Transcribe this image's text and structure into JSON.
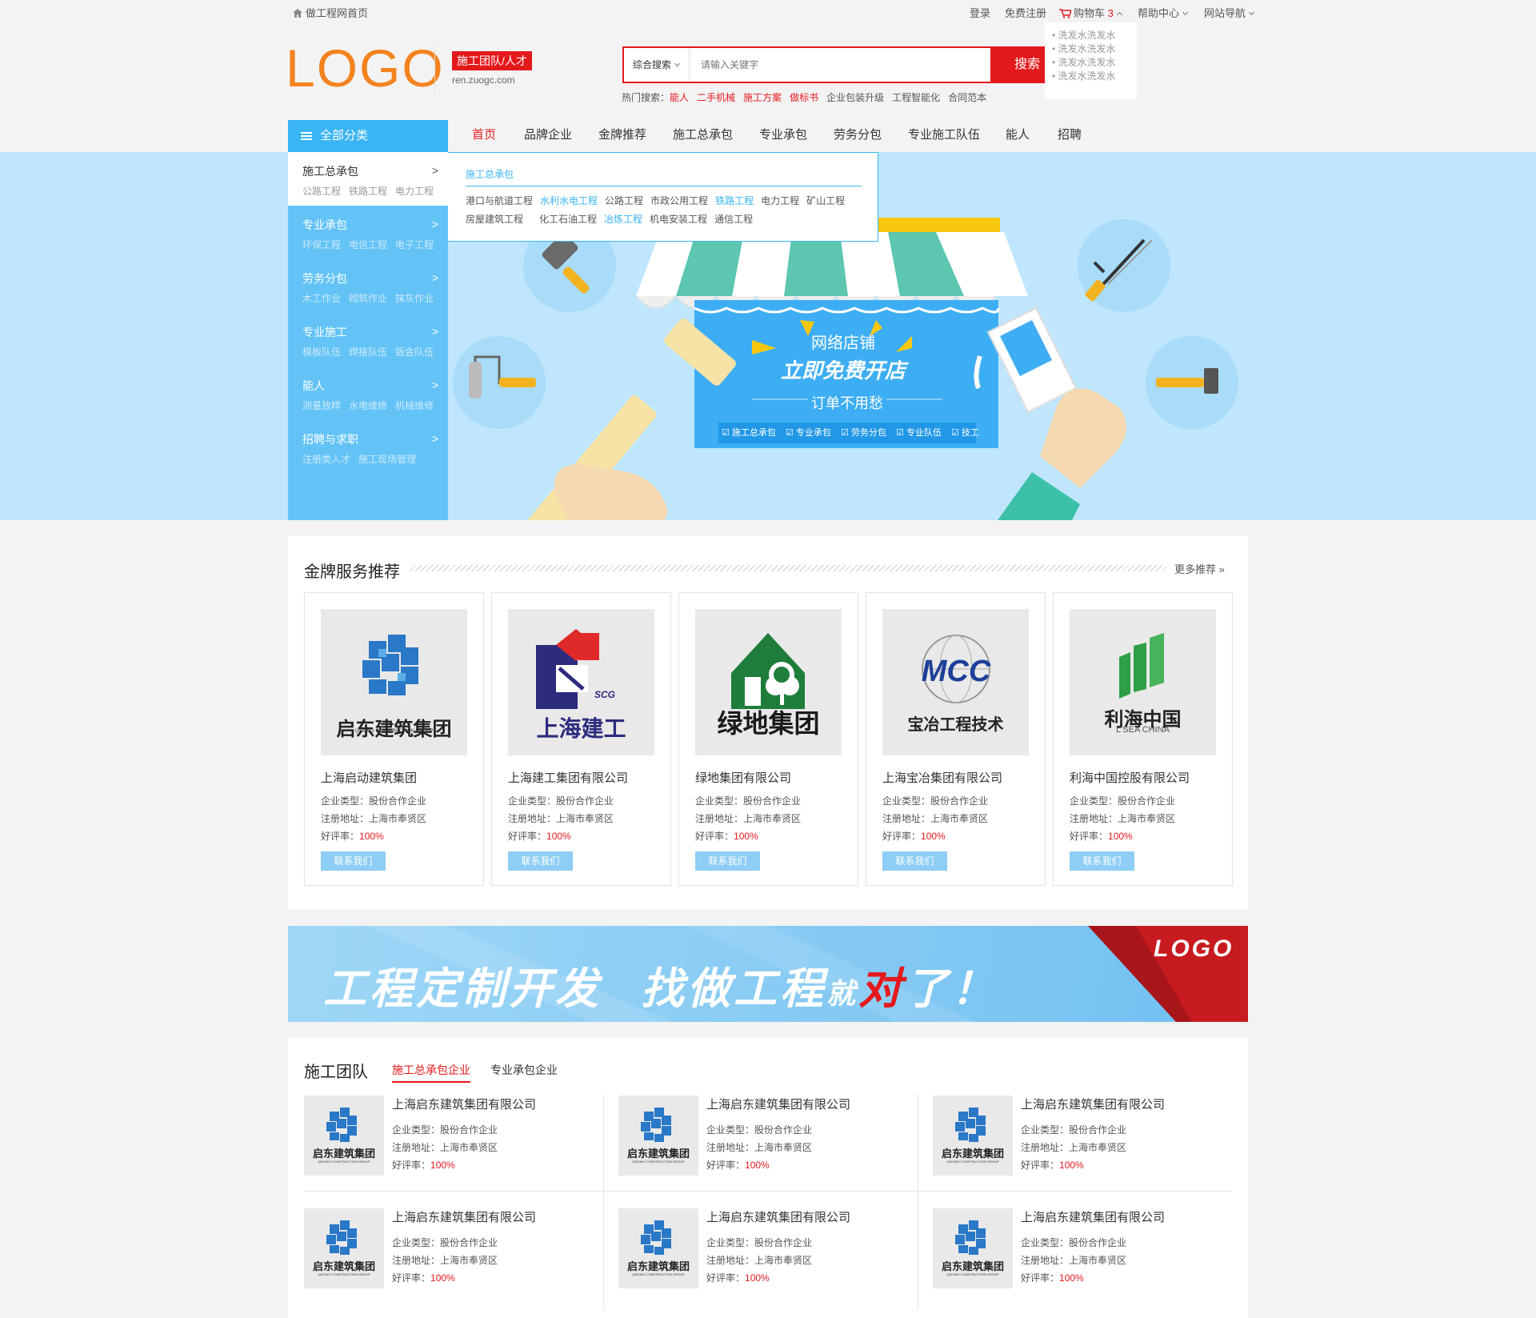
{
  "topbar": {
    "home_link": "做工程网首页",
    "login": "登录",
    "register": "免费注册",
    "cart_label": "购物车",
    "cart_count": "3",
    "help": "帮助中心",
    "sitenav": "网站导航",
    "cart_items": [
      "• 洗发水洗发水",
      "• 洗发水洗发水",
      "• 洗发水洗发水",
      "• 洗发水洗发水"
    ]
  },
  "header": {
    "logo": "LOGO",
    "tag": "施工团队/人才",
    "subsite": "ren.zuogc.com",
    "search_type": "综合搜索",
    "search_placeholder": "请输入关键字",
    "search_button": "搜索",
    "hot_label": "热门搜索：",
    "hot": [
      {
        "t": "能人",
        "red": true
      },
      {
        "t": "二手机械",
        "red": true
      },
      {
        "t": "施工方案",
        "red": true
      },
      {
        "t": "做标书",
        "red": true
      },
      {
        "t": "企业包装升级",
        "red": false
      },
      {
        "t": "工程智能化",
        "red": false
      },
      {
        "t": "合同范本",
        "red": false
      }
    ]
  },
  "nav": {
    "all_categories": "全部分类",
    "items": [
      "首页",
      "品牌企业",
      "金牌推荐",
      "施工总承包",
      "专业承包",
      "劳务分包",
      "专业施工队伍",
      "能人",
      "招聘"
    ]
  },
  "sidebar": [
    {
      "title": "施工总承包",
      "subs": [
        "公路工程",
        "铁路工程",
        "电力工程"
      ]
    },
    {
      "title": "专业承包",
      "subs": [
        "环保工程",
        "电信工程",
        "电子工程"
      ]
    },
    {
      "title": "劳务分包",
      "subs": [
        "木工作业",
        "砌筑作业",
        "抹灰作业"
      ]
    },
    {
      "title": "专业施工",
      "subs": [
        "模板队伍",
        "焊接队伍",
        "钣金队伍"
      ]
    },
    {
      "title": "能人",
      "subs": [
        "测量放样",
        "水电维修",
        "机械维修"
      ]
    },
    {
      "title": "招聘与求职",
      "subs": [
        "注册类人才",
        "施工现场管理"
      ]
    }
  ],
  "flyout": {
    "heading": "施工总承包",
    "row1": [
      {
        "t": "港口与航道工程",
        "b": false
      },
      {
        "t": "水利水电工程",
        "b": true
      },
      {
        "t": "公路工程",
        "b": false
      },
      {
        "t": "市政公用工程",
        "b": false
      },
      {
        "t": "铁路工程",
        "b": true
      },
      {
        "t": "电力工程",
        "b": false
      },
      {
        "t": "矿山工程",
        "b": false
      }
    ],
    "row2": [
      {
        "t": "房屋建筑工程",
        "b": false
      },
      {
        "t": "化工石油工程",
        "b": false
      },
      {
        "t": "冶炼工程",
        "b": true
      },
      {
        "t": "机电安装工程",
        "b": false
      },
      {
        "t": "通信工程",
        "b": false
      }
    ]
  },
  "banner": {
    "line1": "网络店铺",
    "line2": "立即免费开店",
    "line3": "订单不用愁",
    "tags": [
      "施工总承包",
      "专业承包",
      "劳务分包",
      "专业队伍",
      "技工"
    ]
  },
  "gold": {
    "title": "金牌服务推荐",
    "more": "更多推荐",
    "cards": [
      {
        "name": "上海启动建筑集团",
        "logo_text": "启东建筑集团",
        "logo_sub": "QIDONG CONSTRUCTION GROUP",
        "type": "企业类型：股份合作企业",
        "addr": "注册地址：上海市奉贤区",
        "rate_label": "好评率：",
        "rate": "100%",
        "btn": "联系我们"
      },
      {
        "name": "上海建工集团有限公司",
        "logo_text": "上海建工",
        "logo_sub": "SCG",
        "type": "企业类型：股份合作企业",
        "addr": "注册地址：上海市奉贤区",
        "rate_label": "好评率：",
        "rate": "100%",
        "btn": "联系我们"
      },
      {
        "name": "绿地集团有限公司",
        "logo_text": "绿地集团",
        "logo_sub": "",
        "type": "企业类型：股份合作企业",
        "addr": "注册地址：上海市奉贤区",
        "rate_label": "好评率：",
        "rate": "100%",
        "btn": "联系我们"
      },
      {
        "name": "上海宝冶集团有限公司",
        "logo_text": "宝冶工程技术",
        "logo_sub": "MCC",
        "type": "企业类型：股份合作企业",
        "addr": "注册地址：上海市奉贤区",
        "rate_label": "好评率：",
        "rate": "100%",
        "btn": "联系我们"
      },
      {
        "name": "利海中国控股有限公司",
        "logo_text": "利海中国",
        "logo_sub": "L'SEA CHINA",
        "type": "企业类型：股份合作企业",
        "addr": "注册地址：上海市奉贤区",
        "rate_label": "好评率：",
        "rate": "100%",
        "btn": "联系我们"
      }
    ]
  },
  "ad": {
    "slogan_a": "工程定制开发",
    "slogan_b": "找做工程",
    "slogan_c": "就",
    "slogan_d": "对",
    "slogan_e": "了！",
    "logo": "LOGO"
  },
  "team": {
    "title": "施工团队",
    "tabs": [
      "施工总承包企业",
      "专业承包企业"
    ],
    "logo_text": "启东建筑集团",
    "logo_sub": "QIDONG CONSTRUCTION GROUP",
    "items": [
      {
        "name": "上海启东建筑集团有限公司",
        "type": "企业类型：股份合作企业",
        "addr": "注册地址：上海市奉贤区",
        "rate_label": "好评率：",
        "rate": "100%"
      },
      {
        "name": "上海启东建筑集团有限公司",
        "type": "企业类型：股份合作企业",
        "addr": "注册地址：上海市奉贤区",
        "rate_label": "好评率：",
        "rate": "100%"
      },
      {
        "name": "上海启东建筑集团有限公司",
        "type": "企业类型：股份合作企业",
        "addr": "注册地址：上海市奉贤区",
        "rate_label": "好评率：",
        "rate": "100%"
      },
      {
        "name": "上海启东建筑集团有限公司",
        "type": "企业类型：股份合作企业",
        "addr": "注册地址：上海市奉贤区",
        "rate_label": "好评率：",
        "rate": "100%"
      },
      {
        "name": "上海启东建筑集团有限公司",
        "type": "企业类型：股份合作企业",
        "addr": "注册地址：上海市奉贤区",
        "rate_label": "好评率：",
        "rate": "100%"
      },
      {
        "name": "上海启东建筑集团有限公司",
        "type": "企业类型：股份合作企业",
        "addr": "注册地址：上海市奉贤区",
        "rate_label": "好评率：",
        "rate": "100%"
      }
    ]
  },
  "colors": {
    "accent": "#e4191c",
    "blue": "#39b4f4",
    "logo": "#f4831f"
  }
}
